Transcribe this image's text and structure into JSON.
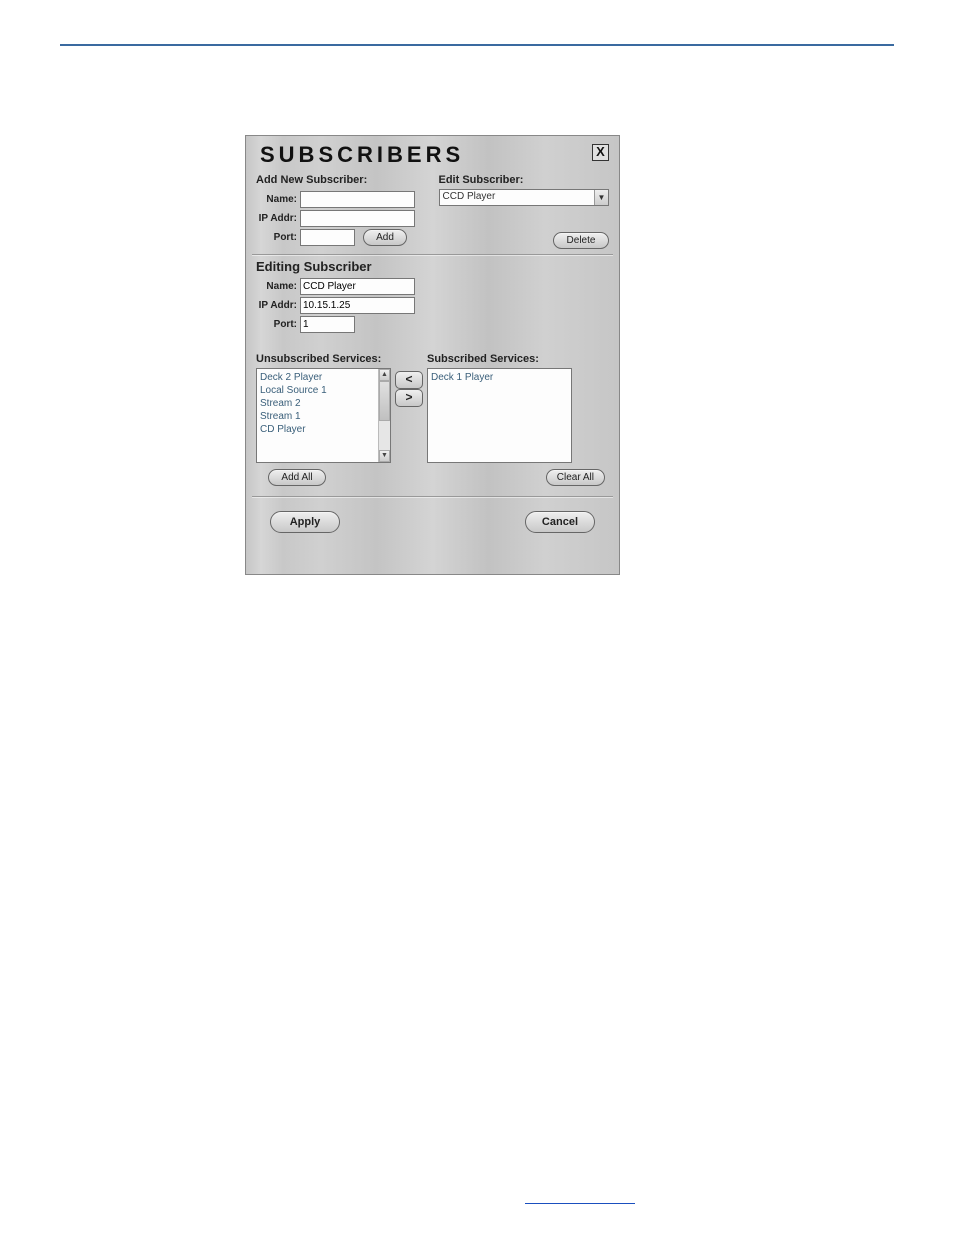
{
  "panel": {
    "title": "SUBSCRIBERS",
    "close": "X"
  },
  "add": {
    "heading": "Add New Subscriber:",
    "name_label": "Name:",
    "name_value": "",
    "ip_label": "IP Addr:",
    "ip_value": "",
    "port_label": "Port:",
    "port_value": "",
    "add_btn": "Add"
  },
  "editselect": {
    "heading": "Edit Subscriber:",
    "selected": "CCD Player",
    "delete_btn": "Delete"
  },
  "editing": {
    "heading": "Editing Subscriber",
    "name_label": "Name:",
    "name_value": "CCD Player",
    "ip_label": "IP Addr:",
    "ip_value": "10.15.1.25",
    "port_label": "Port:",
    "port_value": "1"
  },
  "services": {
    "unsub_label": "Unsubscribed Services:",
    "sub_label": "Subscribed Services:",
    "unsub": [
      "Deck 2 Player",
      "Local Source 1",
      "Stream 2",
      "Stream 1",
      "CD Player"
    ],
    "sub": [
      "Deck 1 Player"
    ],
    "add_all": "Add All",
    "clear_all": "Clear All"
  },
  "buttons": {
    "apply": "Apply",
    "cancel": "Cancel"
  },
  "arrows": {
    "left": "<",
    "right": ">"
  },
  "footer_link": ""
}
